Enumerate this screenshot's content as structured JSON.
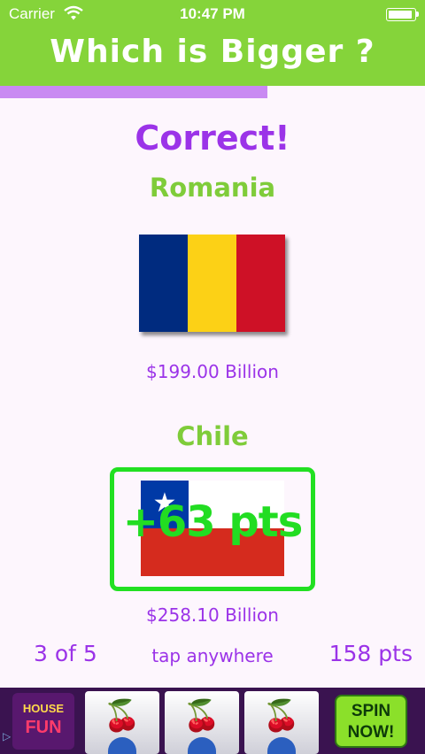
{
  "status_bar": {
    "carrier": "Carrier",
    "time": "10:47 PM",
    "wifi_icon": "wifi-icon",
    "battery_icon": "battery-icon"
  },
  "header": {
    "title": "Which is Bigger ?"
  },
  "progress": {
    "fraction": 0.63,
    "color": "#c98af2"
  },
  "result": {
    "text": "Correct!"
  },
  "top_country": {
    "name": "Romania",
    "value": "$199.00 Billion",
    "flag_colors": [
      "#002b7f",
      "#fcd116",
      "#ce1126"
    ]
  },
  "bottom_country": {
    "name": "Chile",
    "value": "$258.10 Billion",
    "points_gained": "+63 pts",
    "flag_colors": {
      "white": "#ffffff",
      "red": "#d52b1e",
      "blue": "#0039a6"
    },
    "star": "★"
  },
  "footer": {
    "counter": "3 of 5",
    "hint": "tap anywhere",
    "score": "158 pts"
  },
  "ad": {
    "logo_line1": "HOUSE",
    "logo_line2": "FUN",
    "cta_line1": "SPIN",
    "cta_line2": "NOW!",
    "cherry_glyph": "🍒",
    "ad_choices_icon": "ad-choices-icon"
  },
  "colors": {
    "header_green": "#85d43a",
    "accent_purple": "#9b33e8",
    "country_green": "#7fcc3a",
    "success_green": "#22e022",
    "background": "#fdf6fd"
  }
}
